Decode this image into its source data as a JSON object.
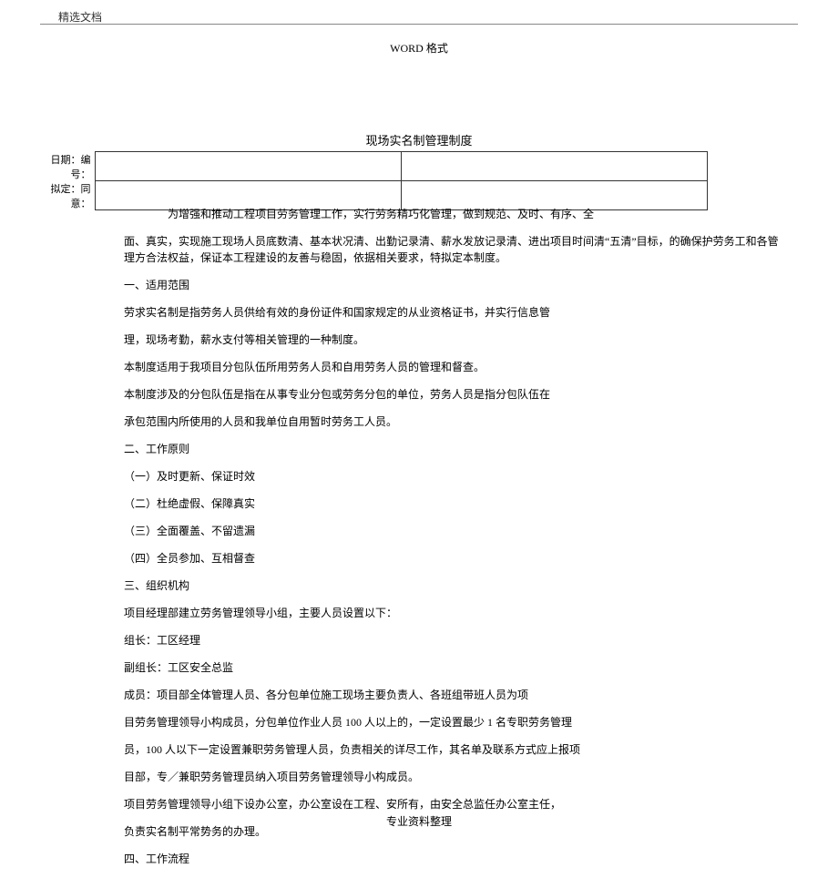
{
  "header": {
    "label": "精选文档",
    "word_format": "WORD 格式"
  },
  "title": "现场实名制管理制度",
  "meta_table": {
    "row1_label": "日期：",
    "row1_label2": "编号：",
    "row2_label": "拟定：",
    "row2_label2": "同意："
  },
  "body": {
    "p1a": "为增强和推动工程项目劳务管理工作，实行劳务精巧化管理，做到规范、及时、有序、全",
    "p1b": "面、真实，实现施工现场人员底数清、基本状况清、出勤记录清、薪水发放记录清、进出项目时间清“五清”目标，的确保护劳务工和各管理方合法权益，保证本工程建设的友善与稳固，依据相关要求，特拟定本制度。",
    "h1": "一、适用范围",
    "p2": "劳求实名制是指劳务人员供给有效的身份证件和国家规定的从业资格证书，并实行信息管",
    "p3": "理，现场考勤，薪水支付等相关管理的一种制度。",
    "p4": "本制度适用于我项目分包队伍所用劳务人员和自用劳务人员的管理和督查。",
    "p5": "本制度涉及的分包队伍是指在从事专业分包或劳务分包的单位，劳务人员是指分包队伍在",
    "p6": "承包范围内所使用的人员和我单位自用暂时劳务工人员。",
    "h2": "二、工作原则",
    "pr1": "（一）及时更新、保证时效",
    "pr2": "（二）杜绝虚假、保障真实",
    "pr3": "（三）全面覆盖、不留遗漏",
    "pr4": "（四）全员参加、互相督查",
    "h3": "三、组织机构",
    "p7": "项目经理部建立劳务管理领导小组，主要人员设置以下：",
    "p8": "组长：工区经理",
    "p9": "副组长：工区安全总监",
    "p10": "成员：项目部全体管理人员、各分包单位施工现场主要负责人、各班组带班人员为项",
    "p11": "目劳务管理领导小构成员，分包单位作业人员 100 人以上的，一定设置最少 1 名专职劳务管理",
    "p12": "员，100 人以下一定设置兼职劳务管理人员，负责相关的详尽工作，其名单及联系方式应上报项",
    "p13": "目部，专／兼职劳务管理员纳入项目劳务管理领导小构成员。",
    "p14": "项目劳务管理领导小组下设办公室，办公室设在工程、安所有，由安全总监任办公室主任，",
    "p15": "负责实名制平常势务的办理。",
    "h4": "四、工作流程"
  },
  "footer": "专业资料整理"
}
